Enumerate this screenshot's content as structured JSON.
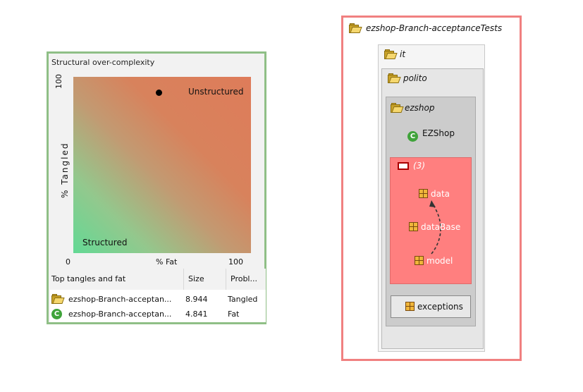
{
  "left_panel": {
    "title": "Structural over-complexity",
    "plot": {
      "unstructured_label": "Unstructured",
      "structured_label": "Structured",
      "y_axis_label": "% Tangled",
      "y_max": "100",
      "x_axis_label": "% Fat",
      "x_min": "0",
      "x_max": "100"
    },
    "table": {
      "headers": [
        "Top tangles and fat",
        "Size",
        "Probl..."
      ],
      "rows": [
        {
          "icon": "folder-icon",
          "name": "ezshop-Branch-acceptan...",
          "size": "8.944",
          "problem": "Tangled"
        },
        {
          "icon": "class-icon",
          "name": "ezshop-Branch-acceptan...",
          "size": "4.841",
          "problem": "Fat"
        }
      ]
    }
  },
  "right_panel": {
    "root_label": "ezshop-Branch-acceptanceTests",
    "it_label": "it",
    "polito_label": "polito",
    "ezshop_label": "ezshop",
    "class_node": {
      "icon_letter": "C",
      "label": "EZShop"
    },
    "cycle_label": "(3)",
    "cycle_nodes": [
      "data",
      "dataBase",
      "model"
    ],
    "exceptions_label": "exceptions"
  },
  "colors": {
    "left_border": "#8fbf86",
    "right_border": "#f08080",
    "cycle_fill": "#ff7f7f"
  }
}
